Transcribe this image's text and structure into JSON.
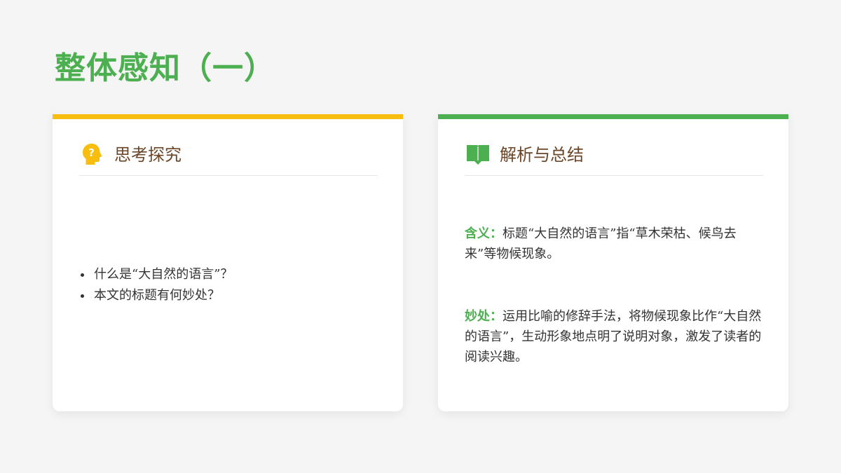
{
  "page": {
    "title": "整体感知（一）"
  },
  "colors": {
    "accent_green": "#4caf50",
    "accent_yellow": "#f7bd0f",
    "card_title_brown": "#6b4628"
  },
  "left_card": {
    "icon": "head-question-icon",
    "title": "思考探究",
    "bullets": [
      "什么是“大自然的语言”？",
      "本文的标题有何妙处？"
    ]
  },
  "right_card": {
    "icon": "open-book-icon",
    "title": "解析与总结",
    "paragraphs": [
      {
        "label": "含义：",
        "text": "标题“大自然的语言”指“草木荣枯、候鸟去来”等物候现象。"
      },
      {
        "label": "妙处：",
        "text": "运用比喻的修辞手法，将物候现象比作“大自然的语言”，生动形象地点明了说明对象，激发了读者的阅读兴趣。"
      }
    ]
  }
}
